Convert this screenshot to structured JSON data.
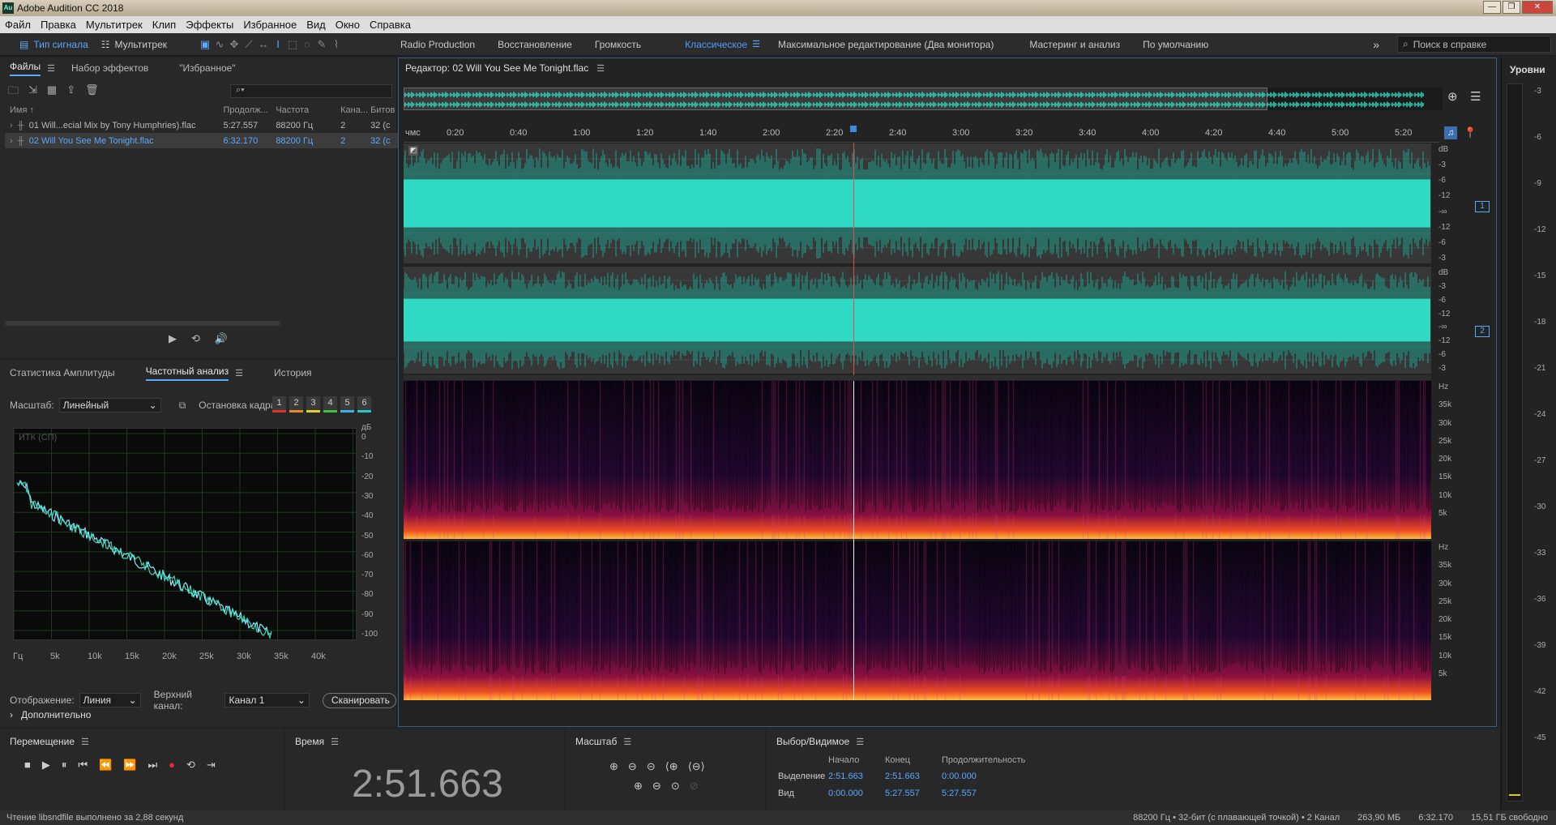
{
  "app": {
    "title": "Adobe Audition CC 2018",
    "icon_text": "Au"
  },
  "window_buttons": {
    "minimize": "—",
    "restore": "❐",
    "close": "✕"
  },
  "menu": [
    "Файл",
    "Правка",
    "Мультитрек",
    "Клип",
    "Эффекты",
    "Избранное",
    "Вид",
    "Окно",
    "Справка"
  ],
  "toolbar": {
    "waveform_label": "Тип сигнала",
    "multitrack_label": "Мультитрек",
    "workspaces": [
      "Radio Production",
      "Восстановление",
      "Громкость",
      "Классическое",
      "Максимальное редактирование (Два монитора)",
      "Мастеринг и анализ",
      "По умолчанию"
    ],
    "active_workspace": "Классическое",
    "more": "»",
    "search_placeholder": "Поиск в справке"
  },
  "files_panel": {
    "tabs": [
      "Файлы",
      "Набор эффектов",
      "\"Избранное\""
    ],
    "search_icon": "⌕▾",
    "columns": [
      "Имя ↑",
      "Продолж...",
      "Частота",
      "Кана...",
      "Битов"
    ],
    "rows": [
      {
        "name": "01 Will...ecial Mix by Tony Humphries).flac",
        "duration": "5:27.557",
        "rate": "88200 Гц",
        "channels": "2",
        "bits": "32 (с"
      },
      {
        "name": "02 Will You See Me Tonight.flac",
        "duration": "6:32.170",
        "rate": "88200 Гц",
        "channels": "2",
        "bits": "32 (с"
      }
    ]
  },
  "analysis_panel": {
    "tabs": [
      "Статистика Амплитуды",
      "Частотный анализ",
      "История"
    ],
    "scale_label": "Масштаб:",
    "scale_value": "Линейный",
    "freeze_label": "Остановка кадра:",
    "freeze_slots": [
      "1",
      "2",
      "3",
      "4",
      "5",
      "6"
    ],
    "freeze_colors": [
      "#e03030",
      "#e08a20",
      "#e0d020",
      "#40c040",
      "#40b0e0",
      "#20c8c8"
    ],
    "graph_label": "ИТК (СП)",
    "db_unit": "дБ",
    "db_ticks": [
      "0",
      "-10",
      "-20",
      "-30",
      "-40",
      "-50",
      "-60",
      "-70",
      "-80",
      "-90",
      "-100"
    ],
    "freq_ticks": [
      "Гц",
      "5k",
      "10k",
      "15k",
      "20k",
      "25k",
      "30k",
      "35k",
      "40k"
    ],
    "display_label": "Отображение:",
    "display_value": "Линия",
    "channel_label": "Верхний канал:",
    "channel_value": "Канал 1",
    "scan_button": "Сканировать",
    "advanced": "Дополнительно"
  },
  "editor": {
    "title": "Редактор: 02 Will You See Me Tonight.flac",
    "time_ticks": [
      "чмс",
      "0:20",
      "0:40",
      "1:00",
      "1:20",
      "1:40",
      "2:00",
      "2:20",
      "2:40",
      "3:00",
      "3:20",
      "3:40",
      "4:00",
      "4:20",
      "4:40",
      "5:00",
      "5:20"
    ],
    "db_scale_top": [
      "dB",
      "-3",
      "-6",
      "-12",
      "-∞",
      "-12",
      "-6",
      "-3"
    ],
    "db_scale_bottom": [
      "dB",
      "-3",
      "-6",
      "-12",
      "-∞",
      "-12",
      "-6",
      "-3"
    ],
    "channel_badges": [
      "1",
      "2"
    ],
    "hz_scale": [
      "Hz",
      "35k",
      "30k",
      "25k",
      "20k",
      "15k",
      "10k",
      "5k"
    ],
    "playhead_fraction": 0.438,
    "colors": {
      "wave": "#2fd9c3",
      "wave_dark": "#1f8f80",
      "playhead": "#e05050"
    }
  },
  "levels": {
    "title": "Уровни",
    "ticks": [
      "-3",
      "-6",
      "-9",
      "-12",
      "-15",
      "-18",
      "-21",
      "-24",
      "-27",
      "-30",
      "-33",
      "-36",
      "-39",
      "-42",
      "-45"
    ]
  },
  "transport": {
    "title": "Перемещение",
    "buttons": [
      "■",
      "▶",
      "⏸",
      "⏮",
      "⏪",
      "⏩",
      "⏭",
      "●",
      "⟲",
      "⇥"
    ]
  },
  "time": {
    "title": "Время",
    "value": "2:51.663"
  },
  "zoom": {
    "title": "Масштаб"
  },
  "selection": {
    "title": "Выбор/Видимое",
    "headers": [
      "Начало",
      "Конец",
      "Продолжительность"
    ],
    "rows": [
      {
        "label": "Выделение",
        "start": "2:51.663",
        "end": "2:51.663",
        "duration": "0:00.000"
      },
      {
        "label": "Вид",
        "start": "0:00.000",
        "end": "5:27.557",
        "duration": "5:27.557"
      }
    ]
  },
  "status": {
    "left": "Чтение libsndfile выполнено за 2,88 секунд",
    "format": "88200 Гц • 32-бит (с плавающей точкой) • 2 Канал",
    "size": "263,90 МБ",
    "duration": "6:32.170",
    "free": "15,51 ГБ свободно"
  }
}
